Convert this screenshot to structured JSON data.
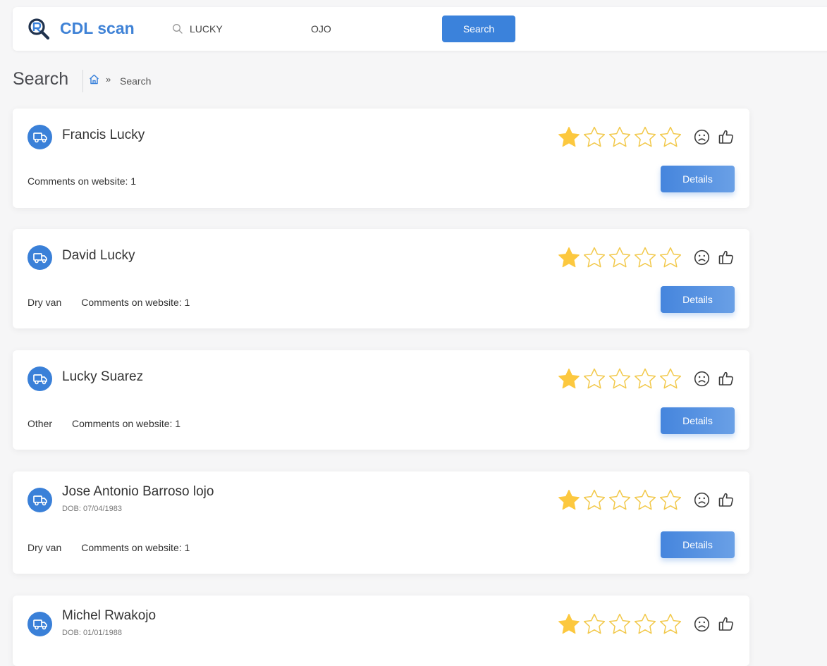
{
  "brand": {
    "name": "CDL scan"
  },
  "search": {
    "first_name": "LUCKY",
    "last_name": "OJO",
    "button_label": "Search"
  },
  "page": {
    "title": "Search",
    "breadcrumb_separator": "»",
    "breadcrumb_current": "Search"
  },
  "rating_colors": {
    "filled": "#fcc83f",
    "outline": "#f2c94c"
  },
  "accent_color": "#3b82db",
  "results": [
    {
      "name": "Francis Lucky",
      "dob": "",
      "tags": [],
      "comments": "Comments on website: 1",
      "rating": 1,
      "details_label": "Details"
    },
    {
      "name": "David Lucky",
      "dob": "",
      "tags": [
        "Dry van"
      ],
      "comments": "Comments on website: 1",
      "rating": 1,
      "details_label": "Details"
    },
    {
      "name": "Lucky Suarez",
      "dob": "",
      "tags": [
        "Other"
      ],
      "comments": "Comments on website: 1",
      "rating": 1,
      "details_label": "Details"
    },
    {
      "name": "Jose Antonio Barroso lojo",
      "dob": "DOB: 07/04/1983",
      "tags": [
        "Dry van"
      ],
      "comments": "Comments on website: 1",
      "rating": 1,
      "details_label": "Details"
    },
    {
      "name": "Michel Rwakojo",
      "dob": "DOB: 01/01/1988",
      "tags": [],
      "comments": "",
      "rating": 1,
      "details_label": ""
    }
  ]
}
